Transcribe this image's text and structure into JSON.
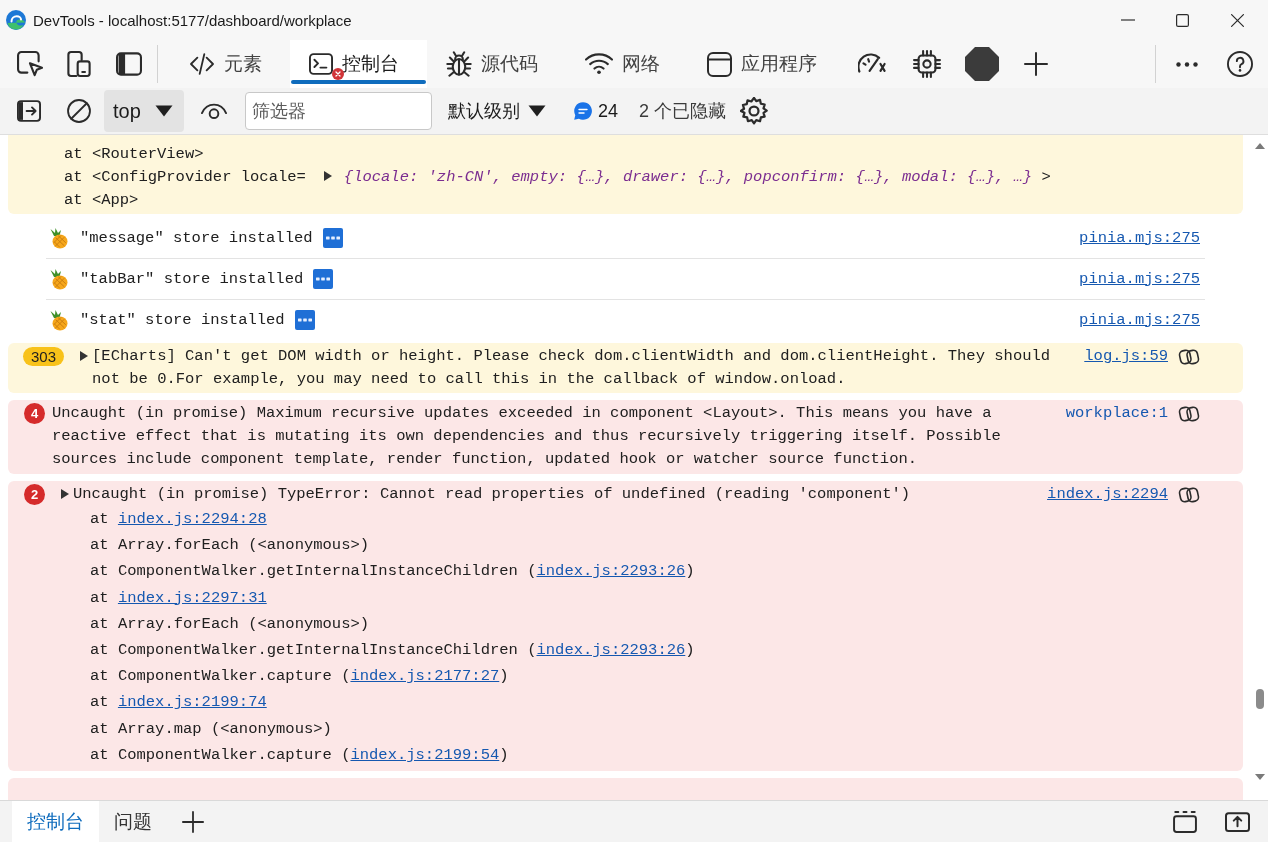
{
  "window": {
    "title": "DevTools - localhost:5177/dashboard/workplace"
  },
  "panel_tabs": [
    {
      "label": "元素",
      "selected": false,
      "error_badge": false
    },
    {
      "label": "控制台",
      "selected": true,
      "error_badge": true
    },
    {
      "label": "源代码",
      "selected": false,
      "error_badge": false
    },
    {
      "label": "网络",
      "selected": false,
      "error_badge": false
    },
    {
      "label": "应用程序",
      "selected": false,
      "error_badge": false
    }
  ],
  "console_toolbar": {
    "context": "top",
    "filter": {
      "placeholder": "筛选器"
    },
    "levels": "默认级别",
    "message_count": "24",
    "hidden_count": "2 个已隐藏"
  },
  "messages": [
    {
      "kind": "warning",
      "stack": [
        {
          "text": "at <RouterView>"
        },
        {
          "text": "at <ConfigProvider locale=",
          "object": "{locale: 'zh-CN', empty: {…}, drawer: {…}, popconfirm: {…}, modal: {…}, …}",
          "suffix": ">"
        },
        {
          "text": "at <App>"
        }
      ]
    },
    {
      "kind": "log",
      "text": "\"message\" store installed",
      "source": {
        "text": "pinia.mjs:275",
        "underlined": true
      }
    },
    {
      "kind": "log",
      "text": "\"tabBar\" store installed",
      "source": {
        "text": "pinia.mjs:275",
        "underlined": true
      }
    },
    {
      "kind": "log",
      "text": "\"stat\" store installed",
      "source": {
        "text": "pinia.mjs:275",
        "underlined": true
      }
    },
    {
      "kind": "warning",
      "count": "303",
      "expandable": true,
      "text": "[ECharts] Can't get DOM width or height. Please check dom.clientWidth and dom.clientHeight. They should not be 0.For example, you may need to call this in the callback of window.onload.",
      "source": {
        "text": "log.js:59",
        "underlined": true
      }
    },
    {
      "kind": "error",
      "count": "4",
      "expandable": false,
      "text": "Uncaught (in promise) Maximum recursive updates exceeded in component <Layout>. This means you have a reactive effect that is mutating its own dependencies and thus recursively triggering itself. Possible sources include component template, render function, updated hook or watcher source function.",
      "source": {
        "text": "workplace:1",
        "underlined": false
      }
    },
    {
      "kind": "error",
      "count": "2",
      "expandable": true,
      "text": "Uncaught (in promise) TypeError: Cannot read properties of undefined (reading 'component')",
      "source": {
        "text": "index.js:2294",
        "underlined": true
      },
      "stack": [
        {
          "text": "at ",
          "link": "index.js:2294:28"
        },
        {
          "text": "at Array.forEach (<anonymous>)"
        },
        {
          "text": "at ComponentWalker.getInternalInstanceChildren (",
          "link": "index.js:2293:26",
          "suffix": ")"
        },
        {
          "text": "at ",
          "link": "index.js:2297:31"
        },
        {
          "text": "at Array.forEach (<anonymous>)"
        },
        {
          "text": "at ComponentWalker.getInternalInstanceChildren (",
          "link": "index.js:2293:26",
          "suffix": ")"
        },
        {
          "text": "at ComponentWalker.capture (",
          "link": "index.js:2177:27",
          "suffix": ")"
        },
        {
          "text": "at ",
          "link": "index.js:2199:74"
        },
        {
          "text": "at Array.map (<anonymous>)"
        },
        {
          "text": "at ComponentWalker.capture (",
          "link": "index.js:2199:54",
          "suffix": ")"
        }
      ]
    },
    {
      "kind": "error",
      "cut_off": true
    }
  ],
  "drawer_tabs": [
    {
      "label": "控制台",
      "selected": true
    },
    {
      "label": "问题",
      "selected": false
    }
  ]
}
